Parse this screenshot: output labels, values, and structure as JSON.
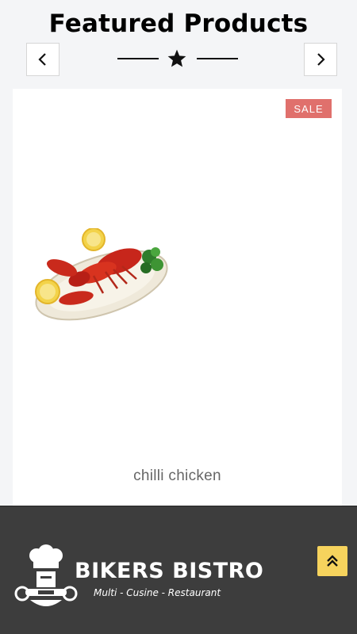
{
  "section": {
    "title": "Featured Products"
  },
  "carousel": {
    "prev_icon": "chevron-left-icon",
    "next_icon": "chevron-right-icon",
    "divider_icon": "star-icon"
  },
  "product": {
    "badge": "SALE",
    "name": "chilli chicken",
    "image_icon": "lobster-plate-image"
  },
  "footer": {
    "logo": {
      "title": "BIKERS BISTRO",
      "tagline": "Multi - Cusine - Restaurant"
    },
    "scroll_top_icon": "double-chevron-up-icon"
  },
  "colors": {
    "page_bg": "#f4f5f7",
    "sale_badge": "#e0706c",
    "footer_bg": "#3d3d3d",
    "scroll_top_bg": "#f6d35d"
  }
}
